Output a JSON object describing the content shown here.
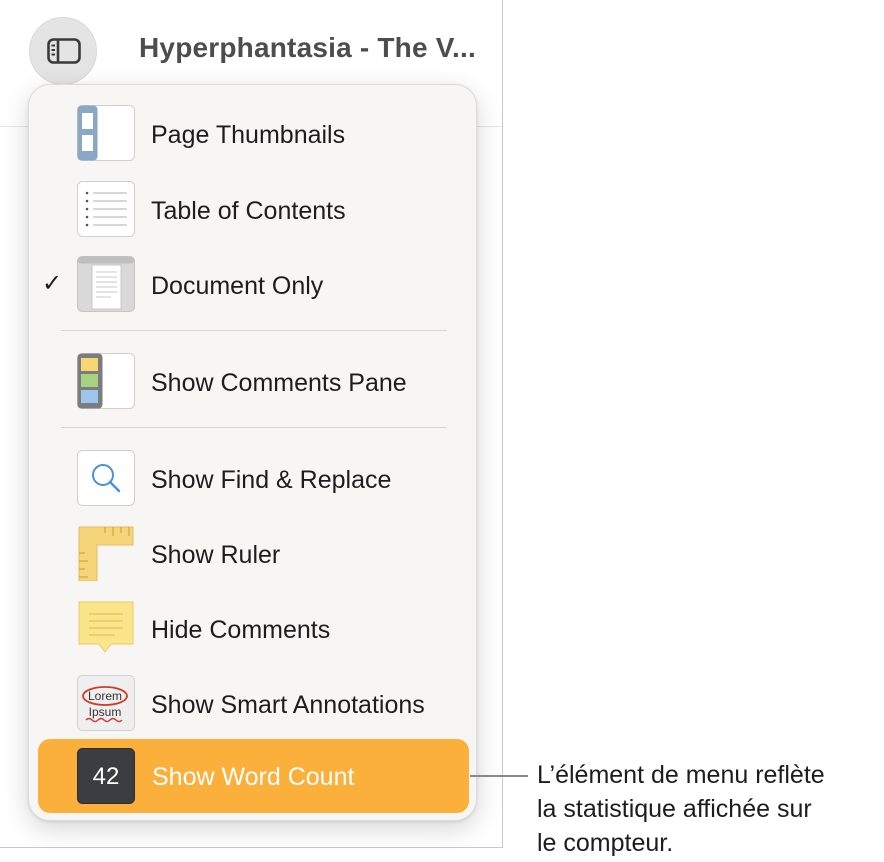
{
  "window": {
    "title": "Hyperphantasia - The V...",
    "view_button_icon": "sidebar-icon"
  },
  "menu": {
    "items": [
      {
        "label": "Page Thumbnails",
        "icon": "page-thumbnails-icon",
        "checked": false
      },
      {
        "label": "Table of Contents",
        "icon": "table-of-contents-icon",
        "checked": false
      },
      {
        "label": "Document Only",
        "icon": "document-only-icon",
        "checked": true
      },
      {
        "label": "Show Comments Pane",
        "icon": "comments-pane-icon",
        "checked": false
      },
      {
        "label": "Show Find & Replace",
        "icon": "magnifier-icon",
        "checked": false
      },
      {
        "label": "Show Ruler",
        "icon": "ruler-icon",
        "checked": false
      },
      {
        "label": "Hide Comments",
        "icon": "comment-note-icon",
        "checked": false
      },
      {
        "label": "Show Smart Annotations",
        "icon": "smart-annotations-icon",
        "checked": false
      },
      {
        "label": "Show Word Count",
        "icon": "word-count-icon",
        "checked": false,
        "highlighted": true,
        "badge": "42"
      }
    ],
    "checkmark": "✓",
    "annotation_icon_text": [
      "Lorem",
      "Ipsum"
    ]
  },
  "callout": {
    "lines": [
      "L’élément de menu reflète",
      "la statistique affichée sur",
      "le compteur."
    ]
  },
  "colors": {
    "highlight": "#fbb03b",
    "menu_bg": "#f7f6f5",
    "accent_blue": "#4a90d9"
  }
}
